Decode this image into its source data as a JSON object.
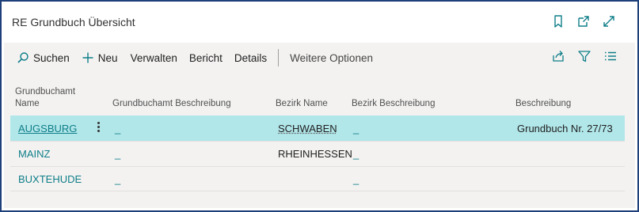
{
  "window": {
    "title": "RE Grundbuch Übersicht",
    "icons": [
      "bookmark-icon",
      "open-in-new-window-icon",
      "expand-icon"
    ]
  },
  "toolbar": {
    "search_label": "Suchen",
    "new_label": "Neu",
    "manage_label": "Verwalten",
    "report_label": "Bericht",
    "details_label": "Details",
    "more_options_label": "Weitere Optionen",
    "right_icons": [
      "share-icon",
      "filter-icon",
      "list-view-icon"
    ]
  },
  "table": {
    "columns": {
      "grundbuchamt_name_line1": "Grundbuchamt",
      "grundbuchamt_name_line2": "Name",
      "grundbuchamt_beschreibung": "Grundbuchamt Beschreibung",
      "bezirk_name": "Bezirk Name",
      "bezirk_beschreibung": "Bezirk Beschreibung",
      "beschreibung": "Beschreibung"
    },
    "rows": [
      {
        "grundbuchamt_name": "AUGSBURG",
        "grundbuchamt_beschreibung": "_",
        "bezirk_name": "SCHWABEN",
        "bezirk_beschreibung": "_",
        "beschreibung": "Grundbuch Nr. 27/73",
        "selected": true
      },
      {
        "grundbuchamt_name": "MAINZ",
        "grundbuchamt_beschreibung": "_",
        "bezirk_name": "RHEINHESSEN",
        "bezirk_beschreibung": "_",
        "beschreibung": "",
        "selected": false
      },
      {
        "grundbuchamt_name": "BUXTEHUDE",
        "grundbuchamt_beschreibung": "_",
        "bezirk_name": "",
        "bezirk_beschreibung": "_",
        "beschreibung": "",
        "selected": false
      }
    ]
  },
  "colors": {
    "frame_border": "#1f3f7a",
    "accent_teal": "#0e7e88",
    "selected_row": "#b2e7ea"
  }
}
